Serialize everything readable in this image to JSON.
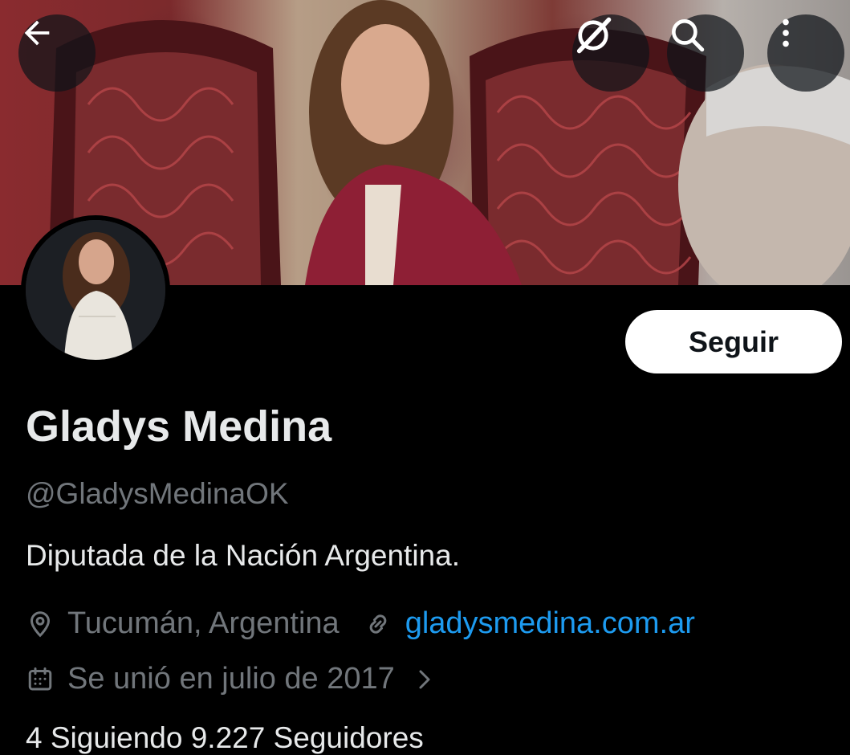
{
  "header": {
    "back_icon": "arrow-left-icon",
    "grok_icon": "grok-icon",
    "search_icon": "search-icon",
    "more_icon": "more-vertical-icon"
  },
  "profile": {
    "display_name": "Gladys Medina",
    "handle": "@GladysMedinaOK",
    "bio": "Diputada de la Nación Argentina.",
    "location": "Tucumán, Argentina",
    "website": "gladysmedina.com.ar",
    "joined": "Se unió en julio de 2017",
    "follow_label": "Seguir",
    "stats_partial": "4 Siguiendo   9.227 Seguidores"
  },
  "colors": {
    "background": "#000000",
    "primary_text": "#e7e9ea",
    "secondary_text": "#71767b",
    "link": "#1d9bf0",
    "button_bg": "#ffffff"
  }
}
